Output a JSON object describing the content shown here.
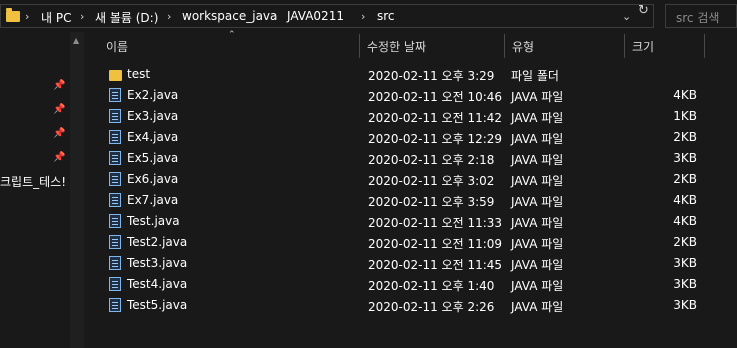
{
  "address": {
    "crumbs": [
      "내 PC",
      "새 볼륨 (D:)",
      "workspace_java",
      "JAVA0211",
      "src"
    ],
    "separator": "›",
    "dropdown_icon": "chevron-down-icon",
    "refresh_icon": "refresh-icon"
  },
  "search": {
    "placeholder": "src 검색"
  },
  "nav": {
    "label": "크립트_테스!"
  },
  "columns": {
    "name": "이름",
    "date": "수정한 날짜",
    "type": "유형",
    "size": "크기"
  },
  "files": [
    {
      "name": "test",
      "date": "2020-02-11 오후 3:29",
      "type": "파일 폴더",
      "size": "",
      "icon": "folder-icon"
    },
    {
      "name": "Ex2.java",
      "date": "2020-02-11 오전 10:46",
      "type": "JAVA 파일",
      "size": "4KB",
      "icon": "java-file-icon"
    },
    {
      "name": "Ex3.java",
      "date": "2020-02-11 오전 11:42",
      "type": "JAVA 파일",
      "size": "1KB",
      "icon": "java-file-icon"
    },
    {
      "name": "Ex4.java",
      "date": "2020-02-11 오후 12:29",
      "type": "JAVA 파일",
      "size": "2KB",
      "icon": "java-file-icon"
    },
    {
      "name": "Ex5.java",
      "date": "2020-02-11 오후 2:18",
      "type": "JAVA 파일",
      "size": "3KB",
      "icon": "java-file-icon"
    },
    {
      "name": "Ex6.java",
      "date": "2020-02-11 오후 3:02",
      "type": "JAVA 파일",
      "size": "2KB",
      "icon": "java-file-icon"
    },
    {
      "name": "Ex7.java",
      "date": "2020-02-11 오후 3:59",
      "type": "JAVA 파일",
      "size": "4KB",
      "icon": "java-file-icon"
    },
    {
      "name": "Test.java",
      "date": "2020-02-11 오전 11:33",
      "type": "JAVA 파일",
      "size": "4KB",
      "icon": "java-file-icon"
    },
    {
      "name": "Test2.java",
      "date": "2020-02-11 오전 11:09",
      "type": "JAVA 파일",
      "size": "2KB",
      "icon": "java-file-icon"
    },
    {
      "name": "Test3.java",
      "date": "2020-02-11 오전 11:45",
      "type": "JAVA 파일",
      "size": "3KB",
      "icon": "java-file-icon"
    },
    {
      "name": "Test4.java",
      "date": "2020-02-11 오후 1:40",
      "type": "JAVA 파일",
      "size": "3KB",
      "icon": "java-file-icon"
    },
    {
      "name": "Test5.java",
      "date": "2020-02-11 오후 2:26",
      "type": "JAVA 파일",
      "size": "3KB",
      "icon": "java-file-icon"
    }
  ]
}
